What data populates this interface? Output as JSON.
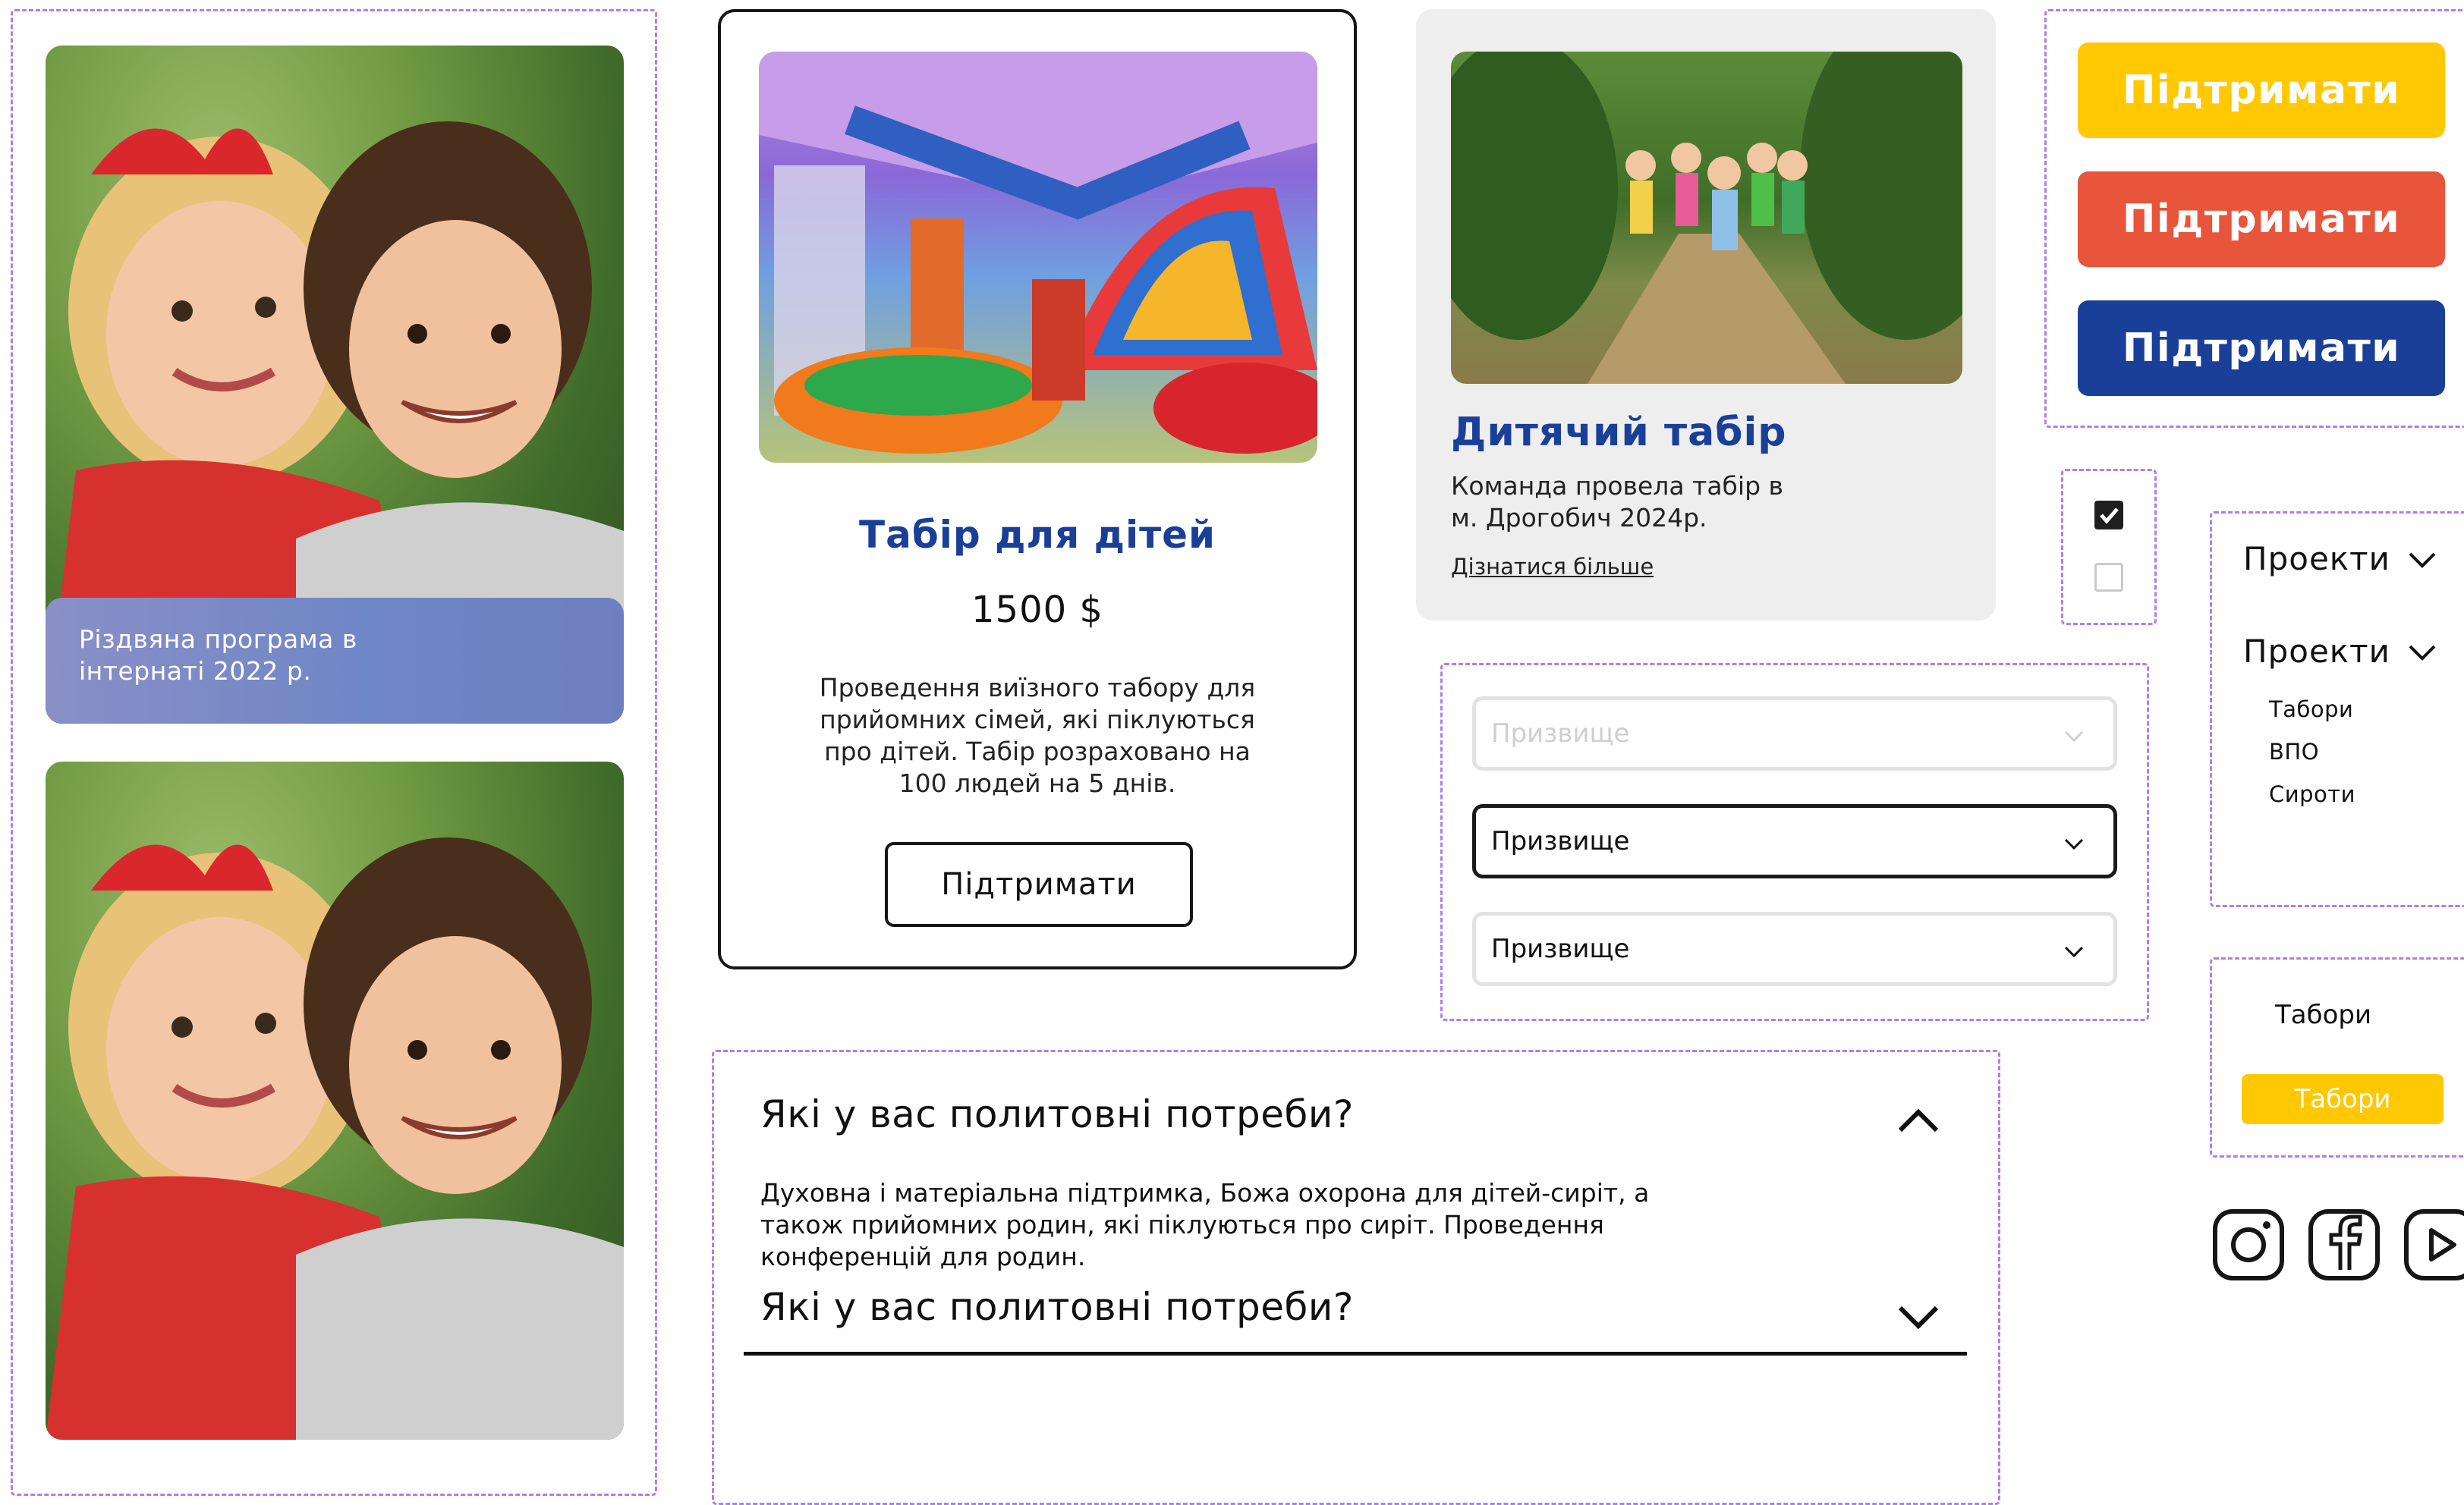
{
  "left_column": {
    "photo_caption": "Різдвяна програма в\nінтернаті 2022 р."
  },
  "camp_card": {
    "title": "Табір для дітей",
    "price": "1500 $",
    "description": "Проведення виїзного табору для\nприйомних сімей, які піклуються\nпро дітей. Табір розраховано на\n100 людей на 5 днів.",
    "button_label": "Підтримати"
  },
  "info_card": {
    "title": "Дитячий табір",
    "text": "Команда провела табір в\nм. Дрогобич  2024р.",
    "link": "Дізнатися більше"
  },
  "support_buttons": {
    "yellow_label": "Підтримати",
    "orange_label": "Підтримати",
    "blue_label": "Підтримати",
    "colors": {
      "yellow": "#FFC800",
      "orange": "#E8553A",
      "blue": "#1A3F99"
    }
  },
  "checkboxes": {
    "first_checked": true,
    "second_checked": false
  },
  "selects": [
    {
      "placeholder": "Призвище",
      "state": "disabled"
    },
    {
      "value": "Призвище",
      "state": "focused"
    },
    {
      "value": "Призвище",
      "state": "default"
    }
  ],
  "nav_menu": {
    "item1": "Проекти",
    "item2": "Проекти",
    "subitems": [
      "Табори",
      "ВПО",
      "Сироти"
    ]
  },
  "tab_states": {
    "plain": "Табори",
    "highlighted": "Табори",
    "highlight_color": "#FFC800"
  },
  "faq": {
    "q1": "Які у вас политовні потреби?",
    "a1": "Духовна і матеріальна підтримка, Божа охорона для дітей-сиріт, а\nтакож прийомних родин, які піклуються про сиріт. Проведення\nконференцій для родин.",
    "q2": "Які у вас политовні потреби?"
  },
  "social_icons": [
    "instagram-icon",
    "facebook-icon",
    "youtube-icon"
  ],
  "colors": {
    "accent_blue": "#1A3F99",
    "dashed_outline": "#B07CF0"
  }
}
